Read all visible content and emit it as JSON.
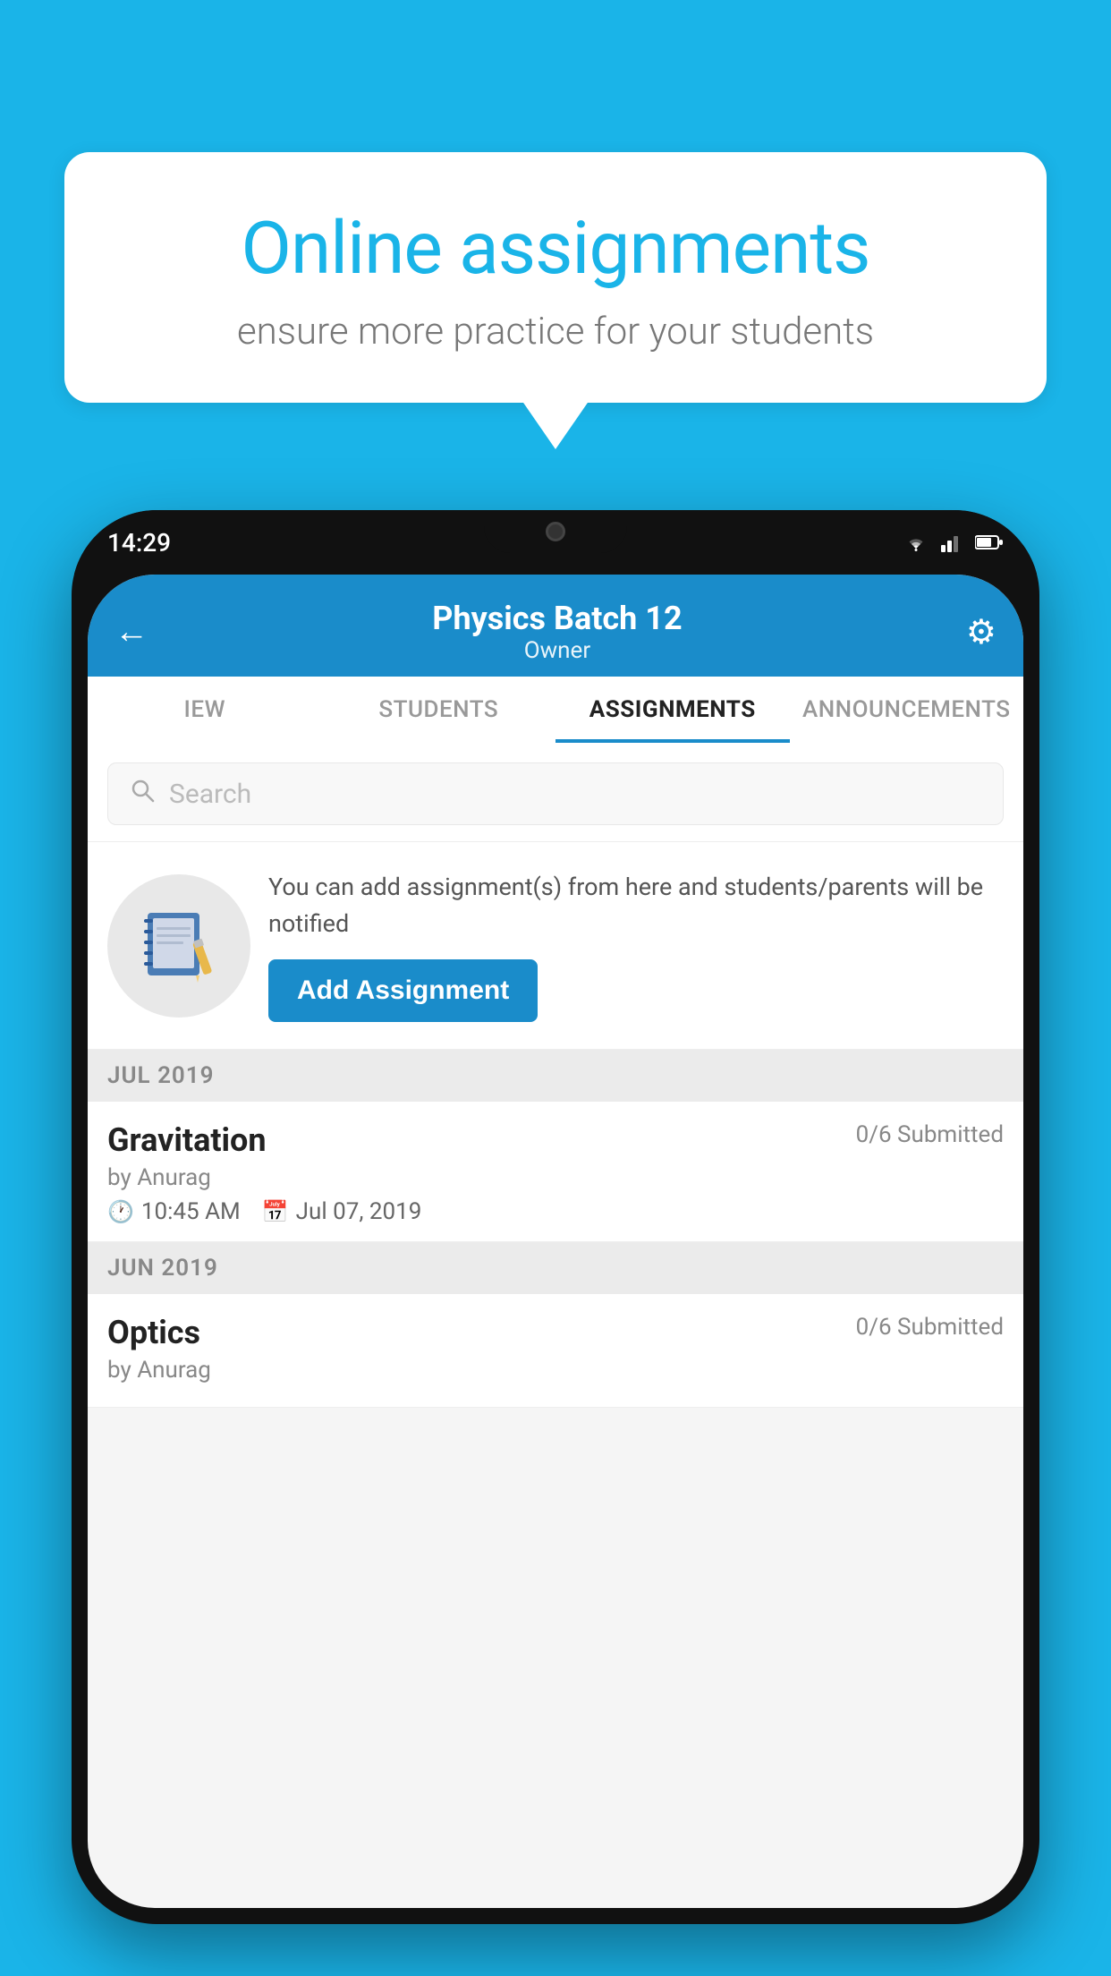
{
  "background_color": "#1ab4e8",
  "speech_bubble": {
    "title": "Online assignments",
    "subtitle": "ensure more practice for your students"
  },
  "phone": {
    "status_bar": {
      "time": "14:29"
    },
    "header": {
      "title": "Physics Batch 12",
      "subtitle": "Owner",
      "back_label": "←",
      "settings_label": "⚙"
    },
    "tabs": [
      {
        "label": "IEW",
        "active": false
      },
      {
        "label": "STUDENTS",
        "active": false
      },
      {
        "label": "ASSIGNMENTS",
        "active": true
      },
      {
        "label": "ANNOUNCEMENTS",
        "active": false
      }
    ],
    "search": {
      "placeholder": "Search"
    },
    "promo": {
      "text": "You can add assignment(s) from here and students/parents will be notified",
      "button_label": "Add Assignment"
    },
    "sections": [
      {
        "month_label": "JUL 2019",
        "assignments": [
          {
            "name": "Gravitation",
            "submitted": "0/6 Submitted",
            "by": "by Anurag",
            "time": "10:45 AM",
            "date": "Jul 07, 2019"
          }
        ]
      },
      {
        "month_label": "JUN 2019",
        "assignments": [
          {
            "name": "Optics",
            "submitted": "0/6 Submitted",
            "by": "by Anurag",
            "time": "",
            "date": ""
          }
        ]
      }
    ]
  }
}
